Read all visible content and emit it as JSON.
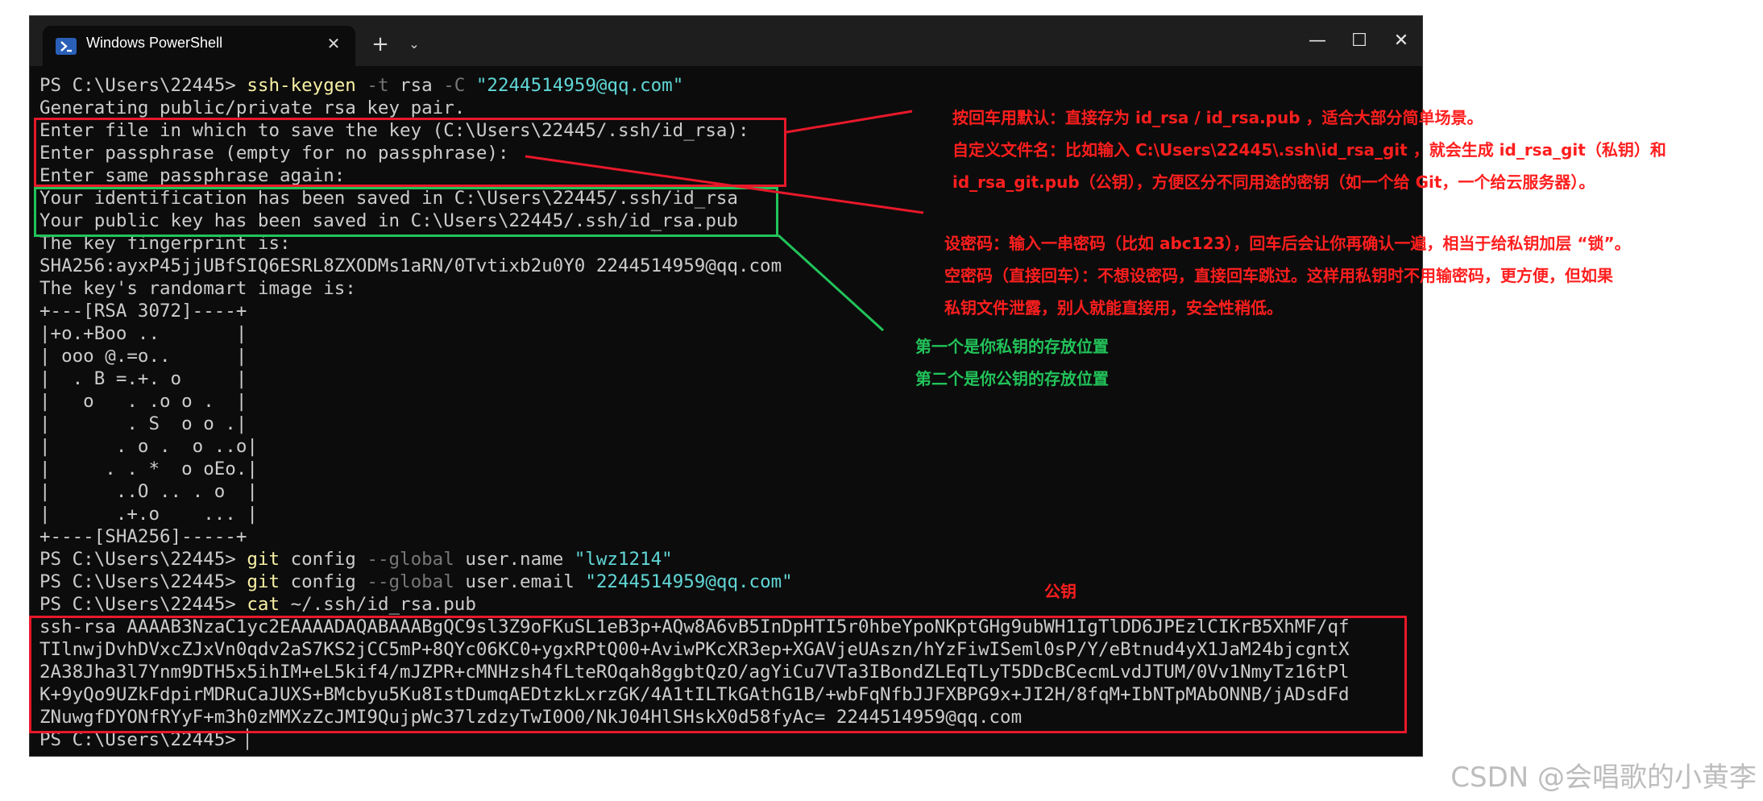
{
  "window": {
    "tab_title": "Windows PowerShell",
    "tab_close": "✕",
    "new_tab": "+",
    "dropdown": "⌄",
    "minimize": "—",
    "maximize": "☐",
    "close": "✕"
  },
  "terminal": {
    "lines": [
      [
        {
          "t": "PS C:\\Users\\22445> ",
          "c": ""
        },
        {
          "t": "ssh-keygen",
          "c": "y"
        },
        {
          "t": " -t ",
          "c": "g"
        },
        {
          "t": "rsa ",
          "c": ""
        },
        {
          "t": "-C ",
          "c": "g"
        },
        {
          "t": "\"2244514959@qq.com\"",
          "c": "b"
        }
      ],
      [
        {
          "t": "Generating public/private rsa key pair.",
          "c": ""
        }
      ],
      [
        {
          "t": "Enter file in which to save the key (C:\\Users\\22445/.ssh/id_rsa):",
          "c": ""
        }
      ],
      [
        {
          "t": "Enter passphrase (empty for no passphrase):",
          "c": ""
        }
      ],
      [
        {
          "t": "Enter same passphrase again:",
          "c": ""
        }
      ],
      [
        {
          "t": "Your identification has been saved in C:\\Users\\22445/.ssh/id_rsa",
          "c": ""
        }
      ],
      [
        {
          "t": "Your public key has been saved in C:\\Users\\22445/.ssh/id_rsa.pub",
          "c": ""
        }
      ],
      [
        {
          "t": "The key fingerprint is:",
          "c": ""
        }
      ],
      [
        {
          "t": "SHA256:ayxP45jjUBfSIQ6ESRL8ZXODMs1aRN/0Tvtixb2u0Y0 2244514959@qq.com",
          "c": ""
        }
      ],
      [
        {
          "t": "The key's randomart image is:",
          "c": ""
        }
      ],
      [
        {
          "t": "+---[RSA 3072]----+",
          "c": ""
        }
      ],
      [
        {
          "t": "|+o.+Boo ..       |",
          "c": ""
        }
      ],
      [
        {
          "t": "| ooo @.=o..      |",
          "c": ""
        }
      ],
      [
        {
          "t": "|  . B =.+. o     |",
          "c": ""
        }
      ],
      [
        {
          "t": "|   o   . .o o .  |",
          "c": ""
        }
      ],
      [
        {
          "t": "|       . S  o o .|",
          "c": ""
        }
      ],
      [
        {
          "t": "|      . o .  o ..o|",
          "c": ""
        }
      ],
      [
        {
          "t": "|     . . *  o oEo.|",
          "c": ""
        }
      ],
      [
        {
          "t": "|      ..O .. . o  |",
          "c": ""
        }
      ],
      [
        {
          "t": "|      .+.o    ... |",
          "c": ""
        }
      ],
      [
        {
          "t": "+----[SHA256]-----+",
          "c": ""
        }
      ],
      [
        {
          "t": "PS C:\\Users\\22445> ",
          "c": ""
        },
        {
          "t": "git",
          "c": "y"
        },
        {
          "t": " config ",
          "c": ""
        },
        {
          "t": "--global",
          "c": "g"
        },
        {
          "t": " user.name ",
          "c": ""
        },
        {
          "t": "\"lwz1214\"",
          "c": "b"
        }
      ],
      [
        {
          "t": "PS C:\\Users\\22445> ",
          "c": ""
        },
        {
          "t": "git",
          "c": "y"
        },
        {
          "t": " config ",
          "c": ""
        },
        {
          "t": "--global",
          "c": "g"
        },
        {
          "t": " user.email ",
          "c": ""
        },
        {
          "t": "\"2244514959@qq.com\"",
          "c": "b"
        }
      ],
      [
        {
          "t": "PS C:\\Users\\22445> ",
          "c": ""
        },
        {
          "t": "cat",
          "c": "y"
        },
        {
          "t": " ~/.ssh/id_rsa.pub",
          "c": ""
        }
      ],
      [
        {
          "t": "ssh-rsa AAAAB3NzaC1yc2EAAAADAQABAAABgQC9sl3Z9oFKuSL1eB3p+AQw8A6vB5InDpHTI5r0hbeYpoNKptGHg9ubWH1IgTlDD6JPEzlCIKrB5XhMF/qf",
          "c": ""
        }
      ],
      [
        {
          "t": "TIlnwjDvhDVxcZJxVn0qdv2aS7KS2jCC5mP+8QYc06KC0+ygxRPtQ00+AviwPKcXR3ep+XGAVjeUAszn/hYzFiwISeml0sP/Y/eBtnud4yX1JaM24bjcgntX",
          "c": ""
        }
      ],
      [
        {
          "t": "2A38Jha3l7Ynm9DTH5x5ihIM+eL5kif4/mJZPR+cMNHzsh4fLteROqah8ggbtQzO/agYiCu7VTa3IBondZLEqTLyT5DDcBCecmLvdJTUM/0Vv1NmyTz16tPl",
          "c": ""
        }
      ],
      [
        {
          "t": "K+9yQo9UZkFdpirMDRuCaJUXS+BMcbyu5Ku8IstDumqAEDtzkLxrzGK/4A1tILTkGAthG1B/+wbFqNfbJJFXBPG9x+JI2H/8fqM+IbNTpMAbONNB/jADsdFd",
          "c": ""
        }
      ],
      [
        {
          "t": "ZNuwgfDYONfRYyF+m3h0zMMXzZcJMI9QujpWc37lzdzyTwI0O0/NkJ04HlSHskX0d58fyAc= 2244514959@qq.com",
          "c": ""
        }
      ],
      [
        {
          "t": "PS C:\\Users\\22445> ",
          "c": ""
        },
        {
          "t": "▏",
          "c": ""
        }
      ]
    ]
  },
  "annotations": {
    "red_1": "按回车用默认：直接存为 id_rsa / id_rsa.pub ，适合大部分简单场景。",
    "red_2": "自定义文件名：比如输入 C:\\Users\\22445\\.ssh\\id_rsa_git ，就会生成 id_rsa_git（私钥）和",
    "red_3": "id_rsa_git.pub（公钥），方便区分不同用途的密钥（如一个给 Git，一个给云服务器）。",
    "red_4": "设密码：输入一串密码（比如 abc123），回车后会让你再确认一遍，相当于给私钥加层 “锁”。",
    "red_5": "空密码（直接回车）：不想设密码，直接回车跳过。这样用私钥时不用输密码，更方便，但如果",
    "red_6": "私钥文件泄露，别人就能直接用，安全性稍低。",
    "green_1": "第一个是你私钥的存放位置",
    "green_2": "第二个是你公钥的存放位置",
    "pubkey_label": "公钥"
  },
  "watermark": "CSDN @会唱歌的小黄李",
  "colors": {
    "terminal_bg": "#0c0c0c",
    "terminal_text": "#cccccc",
    "command_yellow": "#f9f1a5",
    "param_gray": "#767676",
    "string_cyan": "#61d6d6",
    "annotation_red": "#e8182a",
    "annotation_green": "#22c35a"
  }
}
